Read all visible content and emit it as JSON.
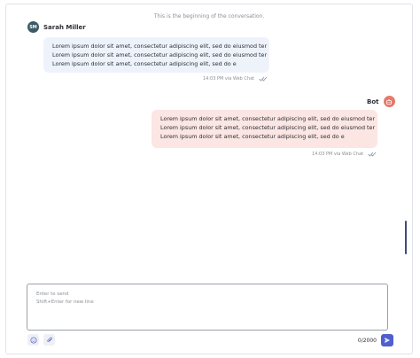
{
  "conversation": {
    "start_notice": "This is the beginning of the conversation."
  },
  "messages": [
    {
      "sender": "Sarah Miller",
      "avatar_initials": "SM",
      "lines": [
        "Lorem ipsum dolor sit amet, consectetur adipiscing elit, sed do eiusmod ter",
        "Lorem ipsum dolor sit amet, consectetur adipiscing elit, sed do eiusmod ter",
        "Lorem ipsum dolor sit amet, consectetur adipiscing elit, sed do e"
      ],
      "meta": "14:03 PM via Web Chat",
      "status_icon": "double-check-icon"
    },
    {
      "sender": "Bot",
      "avatar_icon": "bot-icon",
      "lines": [
        "Lorem ipsum dolor sit amet, consectetur adipiscing elit, sed do eiusmod ter",
        "Lorem ipsum dolor sit amet, consectetur adipiscing elit, sed do eiusmod ter",
        "Lorem ipsum dolor sit amet, consectetur adipiscing elit, sed do e"
      ],
      "meta": "14:03 PM via Web Chat",
      "status_icon": "double-check-icon"
    }
  ],
  "composer": {
    "placeholder_lines": [
      "Enter to send",
      "Shift+Enter for new line"
    ],
    "char_count": "0/2000",
    "emoji_icon": "emoji-icon",
    "attach_icon": "paperclip-icon",
    "send_icon": "send-icon"
  },
  "colors": {
    "incoming_bubble": "#eef3fb",
    "outgoing_bubble": "#fbe6e3",
    "accent": "#4f5fd0",
    "bot_avatar": "#e67a6b",
    "user_avatar": "#3d5a66"
  }
}
